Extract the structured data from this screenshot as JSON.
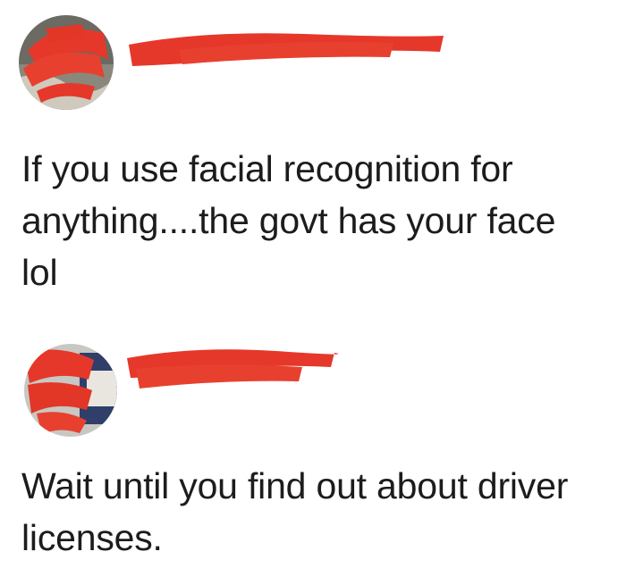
{
  "posts": [
    {
      "text": "If you use facial recognition for\nanything....the govt has your face\nlol"
    },
    {
      "text": "Wait until you find out about driver\nlicenses."
    }
  ],
  "colors": {
    "redaction": "#e5382a",
    "text": "#1c1c1c",
    "background": "#ffffff"
  }
}
